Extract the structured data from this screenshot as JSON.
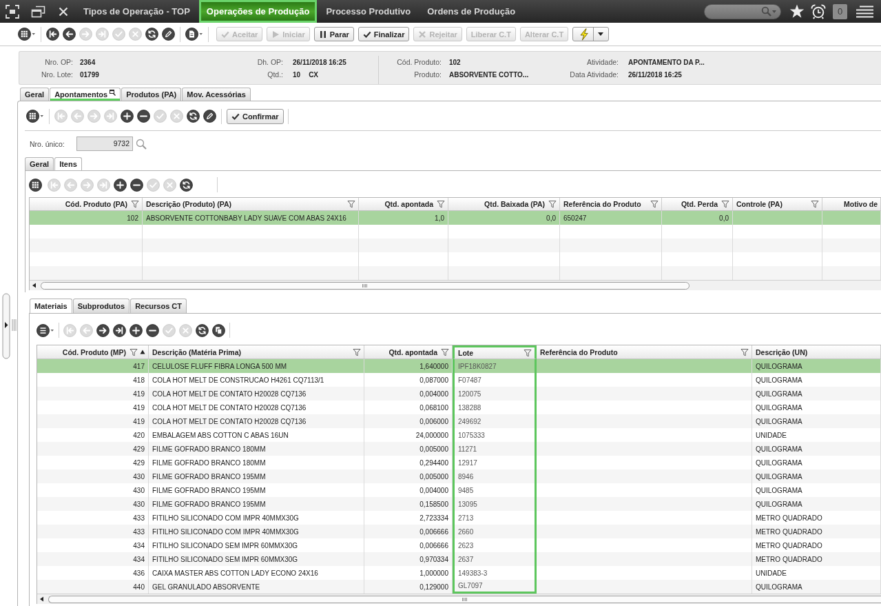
{
  "top_bar": {
    "tabs": [
      {
        "label": "Tipos de Operação - TOP",
        "selected": false
      },
      {
        "label": "Operações de Produção",
        "selected": true
      },
      {
        "label": "Processo Produtivo",
        "selected": false
      },
      {
        "label": "Ordens de Produção",
        "selected": false
      }
    ],
    "notification_count": "0"
  },
  "toolbar": {
    "icons": [
      {
        "disabled": false
      },
      {
        "disabled": false
      },
      {
        "disabled": true
      },
      {
        "disabled": true
      },
      {
        "disabled": true
      },
      {
        "disabled": true
      },
      {
        "disabled": false
      },
      {
        "disabled": false
      }
    ],
    "buttons": [
      {
        "label": "Aceitar",
        "disabled": true
      },
      {
        "label": "Iniciar",
        "disabled": true
      },
      {
        "label": "Parar",
        "disabled": false
      },
      {
        "label": "Finalizar",
        "disabled": false
      },
      {
        "label": "Rejeitar",
        "disabled": true
      },
      {
        "label": "Liberar C.T",
        "disabled": true
      },
      {
        "label": "Alterar C.T",
        "disabled": true
      }
    ]
  },
  "header": {
    "columns": [
      [
        {
          "label": "Nro. OP:",
          "value": "2364"
        },
        {
          "label": "Nro. Lote:",
          "value": "01799"
        }
      ],
      [
        {
          "label": "Dh. OP:",
          "value": "26/11/2018 16:25"
        },
        {
          "label": "Qtd.:",
          "value": "10",
          "unit": "CX"
        }
      ],
      [
        {
          "label": "Cód. Produto:",
          "value": "102"
        },
        {
          "label": "Produto:",
          "value": "ABSORVENTE COTTO..."
        }
      ],
      [
        {
          "label": "Atividade:",
          "value": "APONTAMENTO DA P..."
        },
        {
          "label": "Data Atividade:",
          "value": "26/11/2018 16:25"
        }
      ]
    ]
  },
  "tabs": [
    {
      "label": "Geral",
      "selected": false
    },
    {
      "label": "Apontamentos",
      "selected": true
    },
    {
      "label": "Produtos (PA)",
      "selected": false
    },
    {
      "label": "Mov. Acessórias",
      "selected": false
    }
  ],
  "apontamentos": {
    "toolbar": {
      "icons": [
        {
          "disabled": true
        },
        {
          "disabled": true
        },
        {
          "disabled": true
        },
        {
          "disabled": true
        },
        {
          "disabled": false
        },
        {
          "disabled": false
        },
        {
          "disabled": true
        },
        {
          "disabled": true
        },
        {
          "disabled": false
        },
        {
          "disabled": false
        }
      ],
      "confirm_button": "Confirmar"
    },
    "nro_unico": {
      "label": "Nro. único:",
      "value": "9732"
    },
    "tabs": [
      {
        "label": "Geral",
        "selected": false
      },
      {
        "label": "Itens",
        "selected": true
      }
    ],
    "items_toolbar": {
      "icons": [
        {
          "disabled": true
        },
        {
          "disabled": true
        },
        {
          "disabled": true
        },
        {
          "disabled": true
        },
        {
          "disabled": false
        },
        {
          "disabled": false
        },
        {
          "disabled": true
        },
        {
          "disabled": true
        },
        {
          "disabled": false
        }
      ]
    },
    "items_table": {
      "columns": [
        {
          "label": "Cód. Produto (PA)",
          "kind": "number",
          "filter": true
        },
        {
          "label": "Descrição (Produto) (PA)",
          "kind": "text",
          "filter": true
        },
        {
          "label": "Qtd. apontada",
          "kind": "number",
          "filter": true
        },
        {
          "label": "Qtd. Baixada (PA)",
          "kind": "number",
          "filter": true
        },
        {
          "label": "Referência do Produto",
          "kind": "text",
          "filter": true
        },
        {
          "label": "Qtd. Perda",
          "kind": "number",
          "filter": true
        },
        {
          "label": "Controle (PA)",
          "kind": "text",
          "filter": true
        },
        {
          "label": "Motivo de",
          "kind": "number",
          "filter": false
        }
      ],
      "rows": [
        {
          "selected": true,
          "cells": [
            "102",
            "ABSORVENTE COTTONBABY LADY SUAVE COM ABAS 24X16",
            "1,0",
            "0,0",
            "650247",
            "0,0"
          ]
        }
      ]
    },
    "lower_tabs": [
      {
        "label": "Materiais",
        "selected": true
      },
      {
        "label": "Subprodutos",
        "selected": false
      },
      {
        "label": "Recursos CT",
        "selected": false
      }
    ],
    "materials_toolbar": {
      "icons": [
        {
          "disabled": true
        },
        {
          "disabled": true
        },
        {
          "disabled": false
        },
        {
          "disabled": false
        },
        {
          "disabled": false
        },
        {
          "disabled": false
        },
        {
          "disabled": true
        },
        {
          "disabled": true
        },
        {
          "disabled": false
        },
        {
          "disabled": false
        }
      ]
    },
    "materials_table": {
      "columns": [
        {
          "label": "Cód. Produto (MP)",
          "kind": "number",
          "filter": true,
          "sorted": true,
          "highlighted": false
        },
        {
          "label": "Descrição (Matéria Prima)",
          "kind": "text",
          "filter": true,
          "sorted": false,
          "highlighted": false
        },
        {
          "label": "Qtd. apontada",
          "kind": "number",
          "filter": true,
          "sorted": false,
          "highlighted": false
        },
        {
          "label": "Lote",
          "kind": "text",
          "filter": true,
          "sorted": false,
          "highlighted": true
        },
        {
          "label": "Referência do Produto",
          "kind": "text",
          "filter": true,
          "sorted": false,
          "highlighted": false
        },
        {
          "label": "Descrição (UN)",
          "kind": "text",
          "filter": false,
          "sorted": false,
          "highlighted": false
        }
      ],
      "rows": [
        {
          "selected": true,
          "cells": [
            "417",
            "CELULOSE FLUFF FIBRA LONGA 500 MM",
            "1,640000",
            "IPF18K0827",
            null,
            "QUILOGRAMA"
          ]
        },
        {
          "selected": false,
          "cells": [
            "418",
            "COLA HOT MELT DE CONSTRUCAO H4261 CQ7113/1",
            "0,087000",
            "F07487",
            null,
            "QUILOGRAMA"
          ]
        },
        {
          "selected": false,
          "cells": [
            "419",
            "COLA HOT MELT DE CONTATO H20028 CQ7136",
            "0,004000",
            "120075",
            null,
            "QUILOGRAMA"
          ]
        },
        {
          "selected": false,
          "cells": [
            "419",
            "COLA HOT MELT DE CONTATO H20028 CQ7136",
            "0,068100",
            "138288",
            null,
            "QUILOGRAMA"
          ]
        },
        {
          "selected": false,
          "cells": [
            "419",
            "COLA HOT MELT DE CONTATO H20028 CQ7136",
            "0,006000",
            "249692",
            null,
            "QUILOGRAMA"
          ]
        },
        {
          "selected": false,
          "cells": [
            "420",
            "EMBALAGEM ABS COTTON C ABAS 16UN",
            "24,000000",
            "1075333",
            null,
            "UNIDADE"
          ]
        },
        {
          "selected": false,
          "cells": [
            "429",
            "FILME GOFRADO BRANCO 180MM",
            "0,005000",
            "11271",
            null,
            "QUILOGRAMA"
          ]
        },
        {
          "selected": false,
          "cells": [
            "429",
            "FILME GOFRADO BRANCO 180MM",
            "0,294400",
            "12917",
            null,
            "QUILOGRAMA"
          ]
        },
        {
          "selected": false,
          "cells": [
            "430",
            "FILME GOFRADO BRANCO 195MM",
            "0,005000",
            "8946",
            null,
            "QUILOGRAMA"
          ]
        },
        {
          "selected": false,
          "cells": [
            "430",
            "FILME GOFRADO BRANCO 195MM",
            "0,004000",
            "9485",
            null,
            "QUILOGRAMA"
          ]
        },
        {
          "selected": false,
          "cells": [
            "430",
            "FILME GOFRADO BRANCO 195MM",
            "0,158500",
            "13095",
            null,
            "QUILOGRAMA"
          ]
        },
        {
          "selected": false,
          "cells": [
            "433",
            "FITILHO SILICONADO COM IMPR 40MMX30G",
            "2,723334",
            "2713",
            null,
            "METRO QUADRADO"
          ]
        },
        {
          "selected": false,
          "cells": [
            "433",
            "FITILHO SILICONADO COM IMPR 40MMX30G",
            "0,006666",
            "2660",
            null,
            "METRO QUADRADO"
          ]
        },
        {
          "selected": false,
          "cells": [
            "434",
            "FITILHO SILICONADO SEM IMPR 60MMX30G",
            "0,006666",
            "2623",
            null,
            "METRO QUADRADO"
          ]
        },
        {
          "selected": false,
          "cells": [
            "434",
            "FITILHO SILICONADO SEM IMPR 60MMX30G",
            "0,970334",
            "2637",
            null,
            "METRO QUADRADO"
          ]
        },
        {
          "selected": false,
          "cells": [
            "436",
            "CAIXA MASTER ABS COTTON LADY ECONO 24X16",
            "1,000000",
            "149383-3",
            null,
            "UNIDADE"
          ]
        },
        {
          "selected": false,
          "cells": [
            "440",
            "GEL GRANULADO ABSORVENTE",
            "0,129000",
            "GL7097",
            null,
            "QUILOGRAMA"
          ]
        }
      ]
    }
  }
}
